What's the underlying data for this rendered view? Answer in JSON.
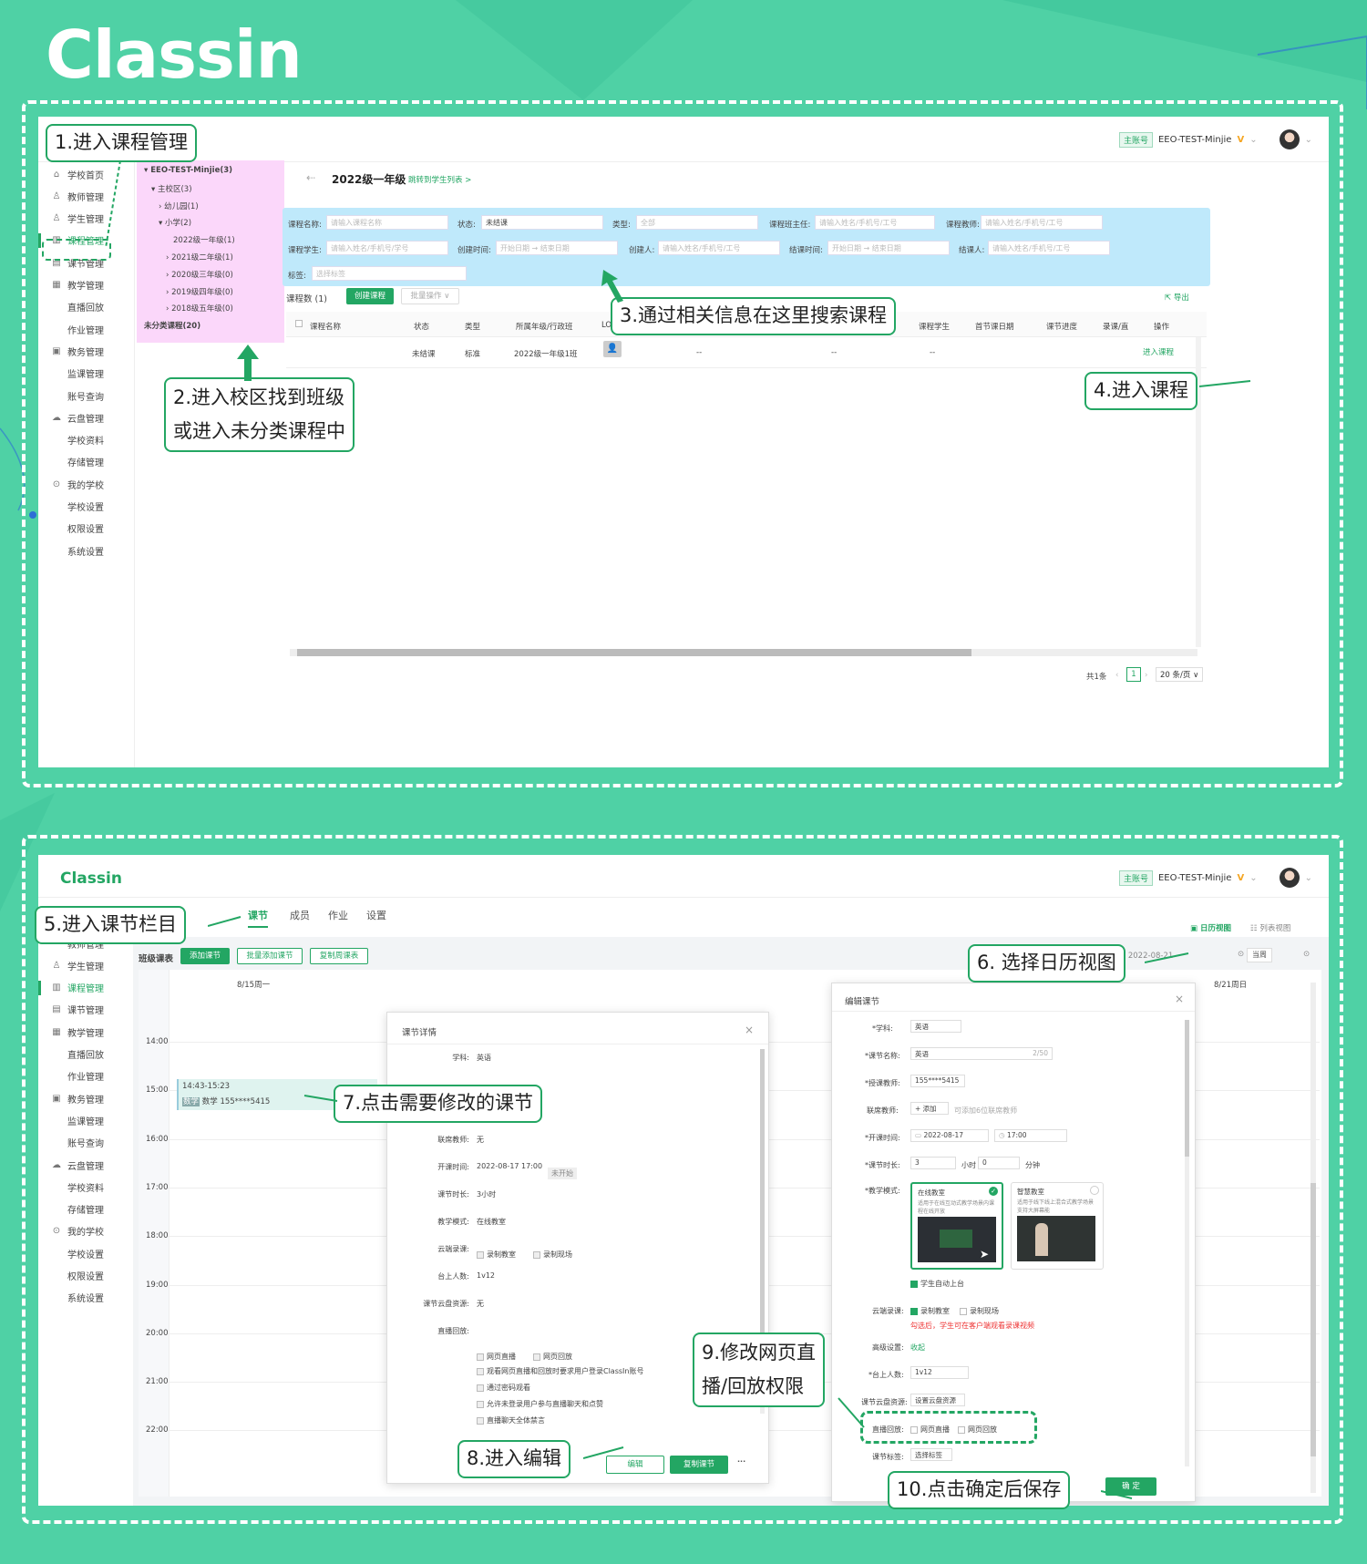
{
  "brand": {
    "logo_text": "Classin"
  },
  "panel1": {
    "topbar": {
      "account_tag": "主账号",
      "account_name": "EEO-TEST-Minjie",
      "vip": "V"
    },
    "sidebar": [
      {
        "label": "学校首页",
        "icon": "home-icon",
        "top": false
      },
      {
        "label": "教师管理",
        "icon": "teacher-icon",
        "top": false
      },
      {
        "label": "学生管理",
        "icon": "student-icon",
        "top": false
      },
      {
        "label": "课程管理",
        "icon": "course-icon",
        "top": false
      },
      {
        "label": "课节管理",
        "icon": "lesson-icon",
        "top": false
      },
      {
        "label": "教学管理",
        "icon": "teach-icon",
        "top": false
      },
      {
        "label": "直播回放",
        "icon": "",
        "top": false
      },
      {
        "label": "作业管理",
        "icon": "",
        "top": false
      },
      {
        "label": "教务管理",
        "icon": "admin-icon",
        "top": false
      },
      {
        "label": "监课管理",
        "icon": "",
        "top": false
      },
      {
        "label": "账号查询",
        "icon": "",
        "top": false
      },
      {
        "label": "云盘管理",
        "icon": "cloud-icon",
        "top": false
      },
      {
        "label": "学校资料",
        "icon": "",
        "top": false
      },
      {
        "label": "存储管理",
        "icon": "",
        "top": false
      },
      {
        "label": "我的学校",
        "icon": "school-icon",
        "top": false
      },
      {
        "label": "学校设置",
        "icon": "",
        "top": false
      },
      {
        "label": "权限设置",
        "icon": "",
        "top": false
      },
      {
        "label": "系统设置",
        "icon": "",
        "top": false
      }
    ],
    "tree": [
      "EEO-TEST-Minjie(3)",
      "主校区(3)",
      "幼儿园(1)",
      "小学(2)",
      "2022级一年级(1)",
      "2021级二年级(1)",
      "2020级三年级(0)",
      "2019级四年级(0)",
      "2018级五年级(0)",
      "未分类课程(20)"
    ],
    "crumb": {
      "title": "2022级一年级",
      "link": "跳转到学生列表 >"
    },
    "filters": {
      "course_name": "课程名称:",
      "course_name_ph": "请输入课程名称",
      "status": "状态:",
      "status_val": "未结课",
      "type": "类型:",
      "type_val": "全部",
      "head_teacher": "课程班主任:",
      "head_teacher_ph": "请输入姓名/手机号/工号",
      "teacher": "课程教师:",
      "teacher_ph": "请输入姓名/手机号/工号",
      "student": "课程学生:",
      "student_ph": "请输入姓名/手机号/学号",
      "created": "创建时间:",
      "start_ph": "开始日期",
      "end_ph": "结束日期",
      "creator": "创建人:",
      "creator_ph": "请输入姓名/手机号/工号",
      "closed": "结课时间:",
      "closer": "结课人:",
      "closer_ph": "请输入姓名/手机号/工号",
      "tag": "标签:",
      "tag_ph": "选择标签"
    },
    "list": {
      "count": "课程数 (1)",
      "create": "创建课程",
      "batch": "批量操作 ∨",
      "export": "导出",
      "headers": [
        "课程名称",
        "状态",
        "类型",
        "所属年级/行政班",
        "LOGO",
        "课程班主任",
        "课程教师",
        "课程学生",
        "首节课日期",
        "课节进度",
        "录课/直",
        "操作"
      ],
      "row": {
        "status": "未结课",
        "type": "标准",
        "grade": "2022级一年级1班",
        "head": "--",
        "teacher": "--",
        "student": "--",
        "action": "进入课程"
      }
    },
    "pager": {
      "total": "共1条",
      "page": "1",
      "size": "20 条/页 ∨"
    },
    "callouts": [
      "1.进入课程管理",
      "2.进入校区找到班级",
      "或进入未分类课程中",
      "3.通过相关信息在这里搜索课程",
      "4.进入课程"
    ]
  },
  "panel2": {
    "logo": "Classin",
    "topbar": {
      "account_tag": "主账号",
      "account_name": "EEO-TEST-Minjie",
      "vip": "V"
    },
    "tabs": [
      "课节",
      "成员",
      "作业",
      "设置"
    ],
    "sidebar": [
      {
        "label": "教师管理",
        "icon": ""
      },
      {
        "label": "学生管理",
        "icon": "student-icon"
      },
      {
        "label": "课程管理",
        "icon": "course-icon"
      },
      {
        "label": "课节管理",
        "icon": "lesson-icon"
      },
      {
        "label": "教学管理",
        "icon": "teach-icon"
      },
      {
        "label": "直播回放",
        "icon": ""
      },
      {
        "label": "作业管理",
        "icon": ""
      },
      {
        "label": "教务管理",
        "icon": "admin-icon"
      },
      {
        "label": "监课管理",
        "icon": ""
      },
      {
        "label": "账号查询",
        "icon": ""
      },
      {
        "label": "云盘管理",
        "icon": "cloud-icon"
      },
      {
        "label": "学校资料",
        "icon": ""
      },
      {
        "label": "存储管理",
        "icon": ""
      },
      {
        "label": "我的学校",
        "icon": "school-icon"
      },
      {
        "label": "学校设置",
        "icon": ""
      },
      {
        "label": "权限设置",
        "icon": ""
      },
      {
        "label": "系统设置",
        "icon": ""
      }
    ],
    "toolbar": {
      "title": "班级课表",
      "add": "添加课节",
      "batch_add": "批量添加课节",
      "copy": "复制周课表",
      "calendar_view": "日历视图",
      "list_view": "列表视图",
      "today": "当周",
      "range": "2022-08-15 - 2022-08-21"
    },
    "days": [
      "8/15周一",
      "8/21周日"
    ],
    "hours": [
      "14:00",
      "15:00",
      "16:00",
      "17:00",
      "18:00",
      "19:00",
      "20:00",
      "21:00",
      "22:00"
    ],
    "event": {
      "time": "14:43-15:23",
      "subject": "数学",
      "teacher": "155****5415"
    },
    "detail": {
      "title": "课节详情",
      "rows": [
        {
          "k": "学科:",
          "v": "英语"
        },
        {
          "k": "联席教师:",
          "v": "无"
        },
        {
          "k": "开课时间:",
          "v": "2022-08-17 17:00"
        },
        {
          "k": "课节时长:",
          "v": "3小时"
        },
        {
          "k": "教学模式:",
          "v": "在线教室"
        },
        {
          "k": "云端录课:",
          "v": ""
        },
        {
          "k": "台上人数:",
          "v": "1v12"
        },
        {
          "k": "课节云盘资源:",
          "v": "无"
        },
        {
          "k": "直播回放:",
          "v": ""
        }
      ],
      "not_started": "未开始",
      "rec_opts": [
        "录制教室",
        "录制现场"
      ],
      "live_opts": [
        "网页直播",
        "网页回放"
      ],
      "live_notes": [
        "观看网页直播和回放时要求用户登录ClassIn账号",
        "通过密码观看",
        "允许未登录用户参与直播聊天和点赞",
        "直播聊天全体禁言"
      ],
      "edit": "编辑",
      "copy": "复制课节",
      "more": "···"
    },
    "editor": {
      "title": "编辑课节",
      "subject_k": "*学科:",
      "subject_v": "英语",
      "name_k": "*课节名称:",
      "name_v": "英语",
      "name_count": "2/50",
      "teacher_k": "*授课教师:",
      "teacher_v": "155****5415",
      "co_k": "联席教师:",
      "co_add": "+ 添加",
      "co_hint": "可添加6位联席教师",
      "time_k": "*开课时间:",
      "date_v": "2022-08-17",
      "clock_v": "17:00",
      "dur_k": "*课节时长:",
      "dur_h": "3",
      "dur_h_unit": "小时",
      "dur_m": "0",
      "dur_m_unit": "分钟",
      "mode_k": "*教学模式:",
      "mode1": "在线教室",
      "mode1_desc": "适用于在线互动式教学场景内课程在线开放",
      "mode2": "智慧教室",
      "mode2_desc": "适用于线下线上混合式教学场景支持大屏幕能",
      "auto_stage": "学生自动上台",
      "rec_k": "云端录课:",
      "rec1": "录制教室",
      "rec2": "录制现场",
      "rec_warn": "勾选后，学生可在客户端观看录课视频",
      "adv_k": "高级设置:",
      "adv_v": "收起",
      "stage_k": "*台上人数:",
      "stage_v": "1v12",
      "cloud_k": "课节云盘资源:",
      "cloud_v": "设置云盘资源",
      "live_k": "直播回放:",
      "live1": "网页直播",
      "live2": "网页回放",
      "tag_k": "课节标签:",
      "tag_v": "选择标签",
      "confirm": "确 定"
    },
    "callouts": [
      "5.进入课节栏目",
      "6. 选择日历视图",
      "7.点击需要修改的课节",
      "8.进入编辑",
      "9.修改网页直",
      "播/回放权限",
      "10.点击确定后保存"
    ]
  }
}
